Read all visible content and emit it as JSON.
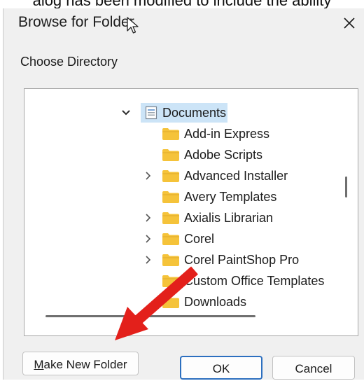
{
  "caption": {
    "text": "alog has been modified to include the ability"
  },
  "dialog": {
    "title": "Browse for Folder",
    "close_glyph": "✕",
    "prompt": "Choose Directory",
    "tree": {
      "root": {
        "label": "Documents",
        "expanded": true,
        "selected": true,
        "icon": "documents-icon"
      },
      "children": [
        {
          "label": "Add-in Express",
          "has_children": false
        },
        {
          "label": "Adobe Scripts",
          "has_children": false
        },
        {
          "label": "Advanced Installer",
          "has_children": true
        },
        {
          "label": "Avery Templates",
          "has_children": false
        },
        {
          "label": "Axialis Librarian",
          "has_children": true
        },
        {
          "label": "Corel",
          "has_children": true
        },
        {
          "label": "Corel PaintShop Pro",
          "has_children": true
        },
        {
          "label": "Custom Office Templates",
          "has_children": false
        },
        {
          "label": "Downloads",
          "has_children": false
        }
      ]
    },
    "buttons": {
      "make_new_folder": {
        "mnemonic": "M",
        "rest": "ake New Folder"
      },
      "ok": "OK",
      "cancel": "Cancel"
    }
  },
  "annotation": {
    "arrow_color": "#e3201b",
    "points_to": "make-new-folder-button"
  },
  "colors": {
    "selection": "#cce4f7",
    "folder": "#f5c33a",
    "focus_border": "#2c6fbf"
  }
}
